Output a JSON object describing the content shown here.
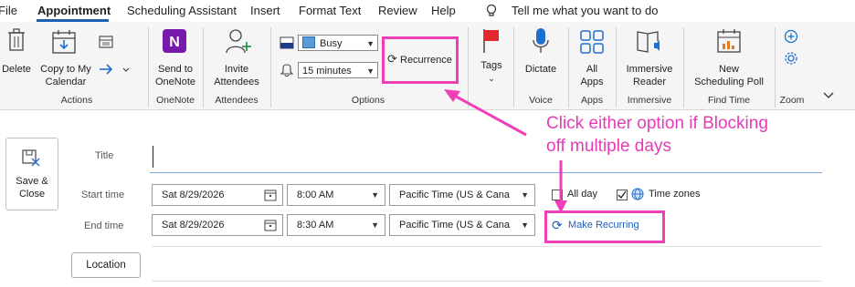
{
  "menu": {
    "items": [
      "File",
      "Appointment",
      "Scheduling Assistant",
      "Insert",
      "Format Text",
      "Review",
      "Help"
    ],
    "tell_me": "Tell me what you want to do"
  },
  "ribbon": {
    "delete": "Delete",
    "copy_to_calendar_1": "Copy to My",
    "copy_to_calendar_2": "Calendar",
    "send_to_onenote_1": "Send to",
    "send_to_onenote_2": "OneNote",
    "invite_attendees_1": "Invite",
    "invite_attendees_2": "Attendees",
    "show_as": "Busy",
    "reminder": "15 minutes",
    "recurrence": "Recurrence",
    "tags": "Tags",
    "dictate": "Dictate",
    "all_apps_1": "All",
    "all_apps_2": "Apps",
    "immersive_reader_1": "Immersive",
    "immersive_reader_2": "Reader",
    "scheduling_poll_1": "New",
    "scheduling_poll_2": "Scheduling Poll",
    "groups": {
      "actions": "Actions",
      "onenote": "OneNote",
      "attendees": "Attendees",
      "options": "Options",
      "voice": "Voice",
      "apps": "Apps",
      "immersive": "Immersive",
      "find_time": "Find Time",
      "zoom": "Zoom"
    }
  },
  "form": {
    "save_close_1": "Save &",
    "save_close_2": "Close",
    "title_label": "Title",
    "start_label": "Start time",
    "end_label": "End time",
    "start_date": "Sat 8/29/2026",
    "start_time": "8:00 AM",
    "start_tz": "Pacific Time (US & Cana",
    "end_date": "Sat 8/29/2026",
    "end_time": "8:30 AM",
    "end_tz": "Pacific Time (US & Cana",
    "all_day": "All day",
    "time_zones": "Time zones",
    "make_recurring": "Make Recurring",
    "location": "Location"
  },
  "annotation": {
    "line1": "Click either option if Blocking",
    "line2": "off multiple days"
  },
  "colors": {
    "annotation": "#e63bb6",
    "accent": "#1f5fb4"
  }
}
